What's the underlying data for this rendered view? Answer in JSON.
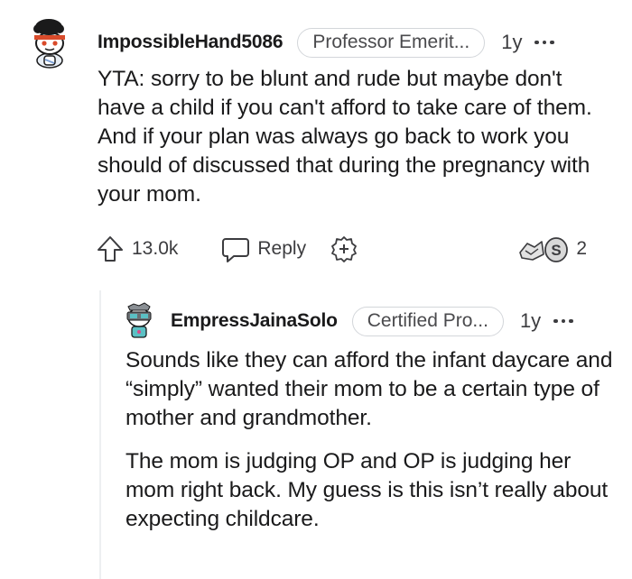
{
  "comments": [
    {
      "username": "ImpossibleHand5086",
      "flair": "Professor Emerit...",
      "age": "1y",
      "body": [
        "YTA: sorry to be blunt and rude but maybe don't have a child if you can't afford to take care of them. And if your plan was always go back to work you should of discussed that during the pregnancy with your mom."
      ],
      "votes": "13.0k",
      "reply_label": "Reply",
      "award_count": "2"
    },
    {
      "username": "EmpressJainaSolo",
      "flair": "Certified Pro...",
      "age": "1y",
      "body": [
        "Sounds like they can afford the infant daycare and “simply” wanted their mom to be a certain type of mother and grandmother.",
        "The mom is judging OP and OP is judging her mom right back. My guess is this isn’t really about expecting childcare."
      ]
    }
  ],
  "icons": {
    "upvote": "upvote-arrow-icon",
    "reply": "speech-bubble-icon",
    "award": "plus-circle-icon",
    "awards": "awards-icon",
    "more": "ellipsis-icon"
  },
  "colors": {
    "text": "#1a1a1b",
    "meta": "#3c3c3f",
    "border": "#d3d6da",
    "thread_line": "#edeff1"
  }
}
